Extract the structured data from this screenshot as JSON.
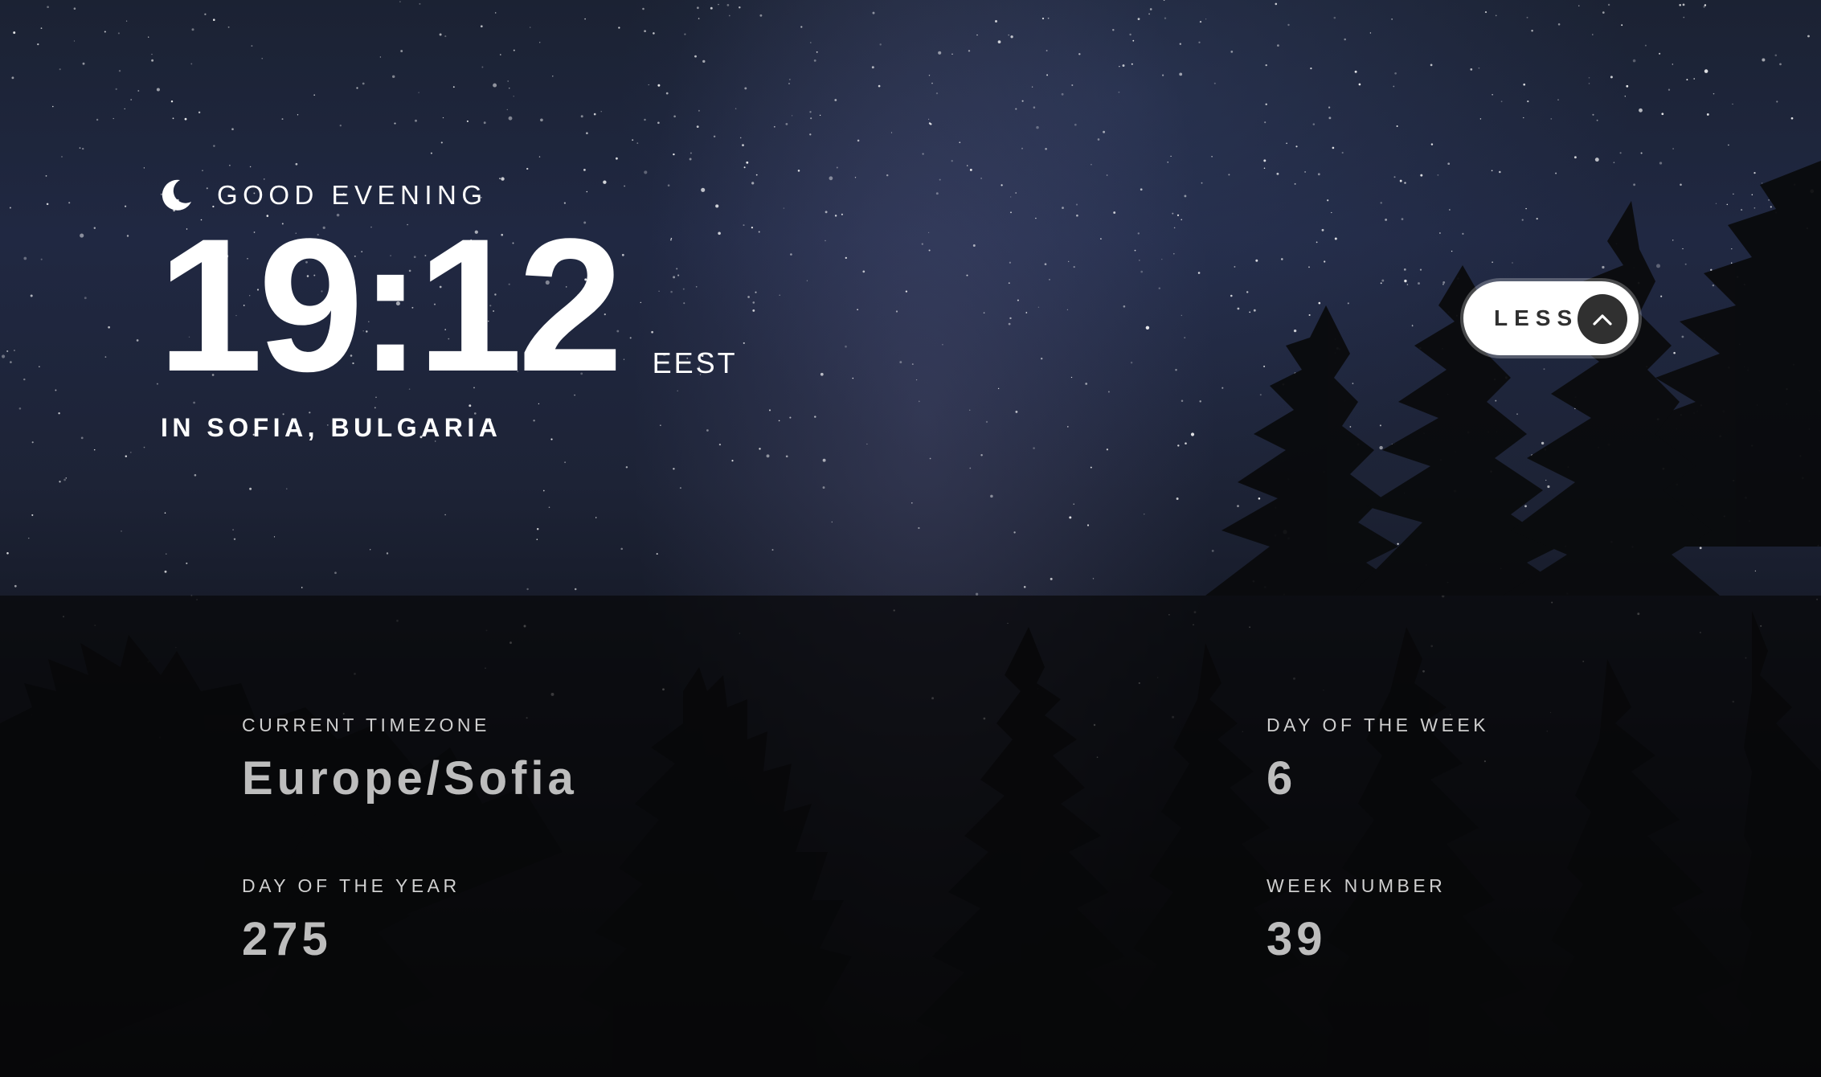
{
  "greeting": {
    "icon": "moon-icon",
    "text": "GOOD EVENING"
  },
  "clock": {
    "time": "19:12",
    "abbreviation": "EEST",
    "location": "IN SOFIA, BULGARIA"
  },
  "toggle": {
    "label": "LESS",
    "icon": "chevron-up-icon"
  },
  "details": {
    "timezone_label": "CURRENT TIMEZONE",
    "timezone_value": "Europe/Sofia",
    "day_of_year_label": "DAY OF THE YEAR",
    "day_of_year_value": "275",
    "day_of_week_label": "DAY OF THE WEEK",
    "day_of_week_value": "6",
    "week_number_label": "WEEK NUMBER",
    "week_number_value": "39"
  },
  "colors": {
    "text_primary": "#ffffff",
    "panel_overlay": "#08080a",
    "button_bg": "#ffffff",
    "button_fg": "#303030",
    "detail_value": "#bdbdbd"
  }
}
